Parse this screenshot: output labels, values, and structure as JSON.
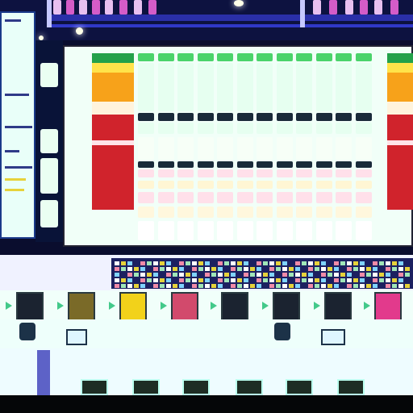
{
  "app": {
    "kind": "daw-mixer-console"
  },
  "colors": {
    "background": "#0a0d2e",
    "panel": "#f1fff8",
    "accent_blue": "#2a2fa8",
    "meter_red": "#d0232c",
    "meter_orange": "#f7a21a",
    "meter_yellow": "#ffe34a",
    "meter_green": "#4ad36a",
    "clip_yellow": "#f2d21a",
    "clip_magenta": "#e23a8c",
    "clip_dark": "#1b2330"
  },
  "mixer": {
    "channel_count": 12,
    "icons": {
      "play": "play-icon",
      "knob": "knob-icon",
      "clip": "clip-slot-icon"
    }
  },
  "clip_slots": [
    {
      "color": "#1b2330"
    },
    {
      "color": "#7a6a28"
    },
    {
      "color": "#f2d21a"
    },
    {
      "color": "#d24a6c"
    },
    {
      "color": "#1b2330"
    },
    {
      "color": "#1b2330"
    },
    {
      "color": "#1b2330"
    },
    {
      "color": "#e23a8c"
    }
  ]
}
